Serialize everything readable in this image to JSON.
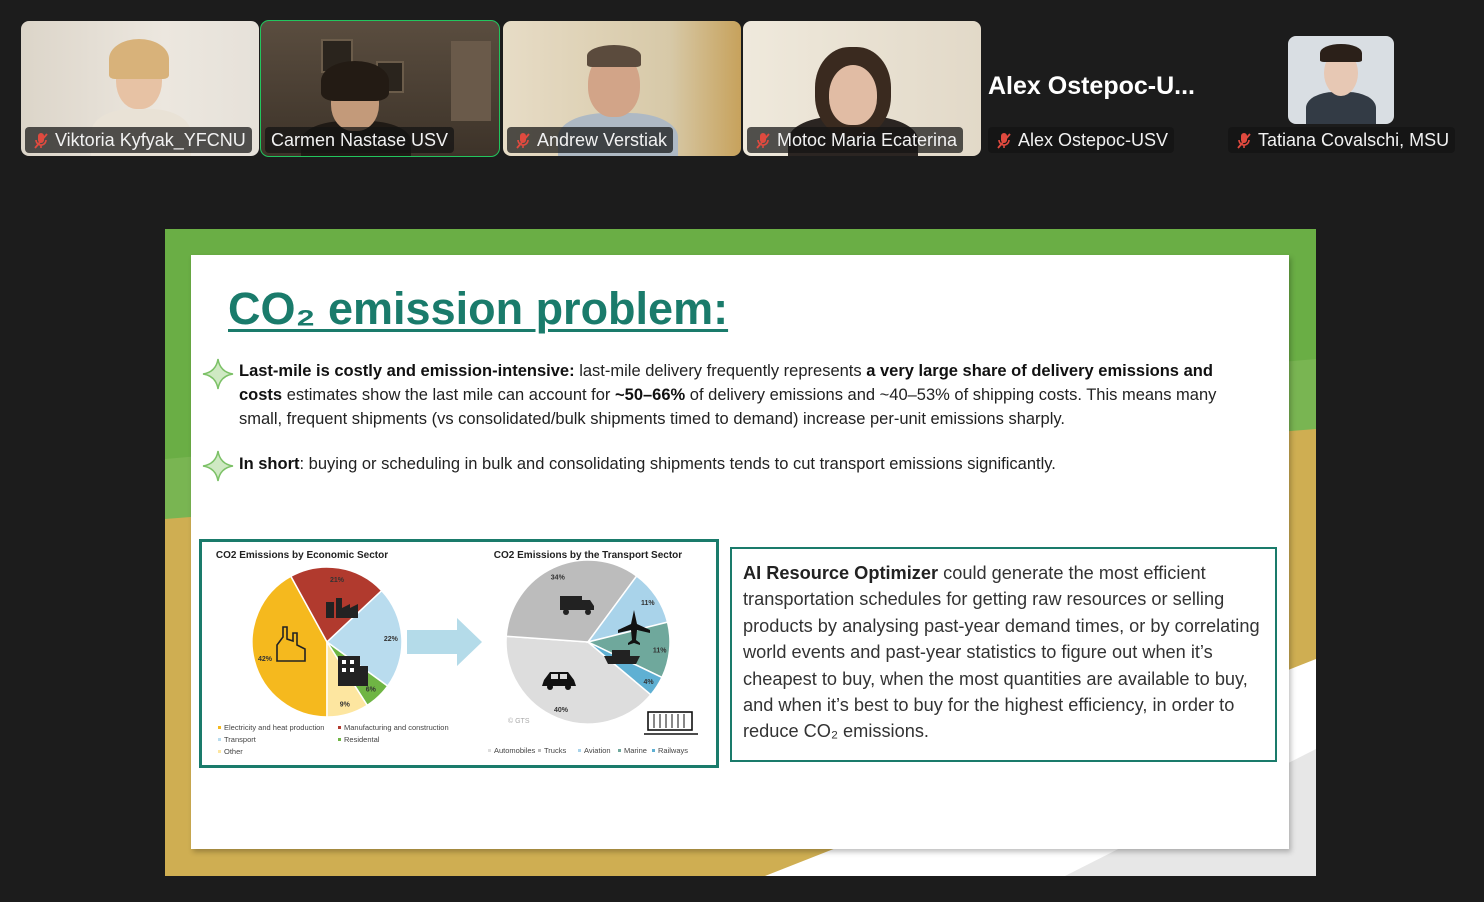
{
  "participants": [
    {
      "name": "Viktoria Kyfyak_YFCNU",
      "muted": true
    },
    {
      "name": "Carmen Nastase USV",
      "muted": true,
      "active_speaker": true
    },
    {
      "name": "Andrew Verstiak",
      "muted": true
    },
    {
      "name": "Motoc Maria Ecaterina",
      "muted": true
    },
    {
      "name": "Alex Ostepoc-USV",
      "muted": true,
      "display_text": "Alex  Ostepoc-U..."
    },
    {
      "name": "Tatiana Covalschi, MSU",
      "muted": true
    }
  ],
  "slide": {
    "title": "CO₂ emission problem:",
    "bullets": [
      {
        "b1": "Last-mile is costly and emission-intensive:",
        "t1": " last-mile delivery frequently represents ",
        "b2": "a very large share of delivery emissions and costs",
        "t2": " estimates show the last mile can account for ",
        "b3": "~50–66%",
        "t3": " of delivery emissions and ~40–53% of shipping costs. This means many small, frequent shipments (vs consolidated/bulk shipments timed to demand) increase per-unit emissions sharply."
      },
      {
        "b1": "In short",
        "t1": ": buying or scheduling in bulk and consolidating shipments tends to cut transport emissions significantly."
      }
    ],
    "ai_box": {
      "bold": "AI Resource Optimizer",
      "text": " could generate the most efficient transportation schedules for getting raw resources or selling products by analysing past-year demand times, or by correlating world events and past-year statistics to figure out when it’s cheapest to buy, when the most quantities are available to buy, and when it’s best to buy for the highest efficiency, in order to reduce CO₂ emissions."
    }
  },
  "chart_data": [
    {
      "type": "pie",
      "title": "CO2 Emissions by Economic Sector",
      "slices": [
        {
          "label": "Electricity and heat production",
          "value": 42,
          "color": "#f5b91e"
        },
        {
          "label": "Manufacturing and construction",
          "value": 21,
          "color": "#b13a2e"
        },
        {
          "label": "Transport",
          "value": 22,
          "color": "#b9dcee"
        },
        {
          "label": "Residental",
          "value": 6,
          "color": "#6fb544"
        },
        {
          "label": "Other",
          "value": 9,
          "color": "#fde6a0"
        }
      ]
    },
    {
      "type": "pie",
      "title": "CO2 Emissions by the Transport Sector",
      "slices": [
        {
          "label": "Automobiles",
          "value": 40,
          "color": "#dddddd"
        },
        {
          "label": "Trucks",
          "value": 34,
          "color": "#bcbcbc"
        },
        {
          "label": "Aviation",
          "value": 11,
          "color": "#a9d3ea"
        },
        {
          "label": "Marine",
          "value": 11,
          "color": "#6fa89c"
        },
        {
          "label": "Railways",
          "value": 4,
          "color": "#5fb0d3"
        }
      ],
      "watermark": "© GTS"
    }
  ],
  "icons": [
    "microphone-muted-icon",
    "sparkle-star-icon",
    "factory-icon",
    "buildings-icon",
    "houses-icon",
    "truck-icon",
    "airplane-icon",
    "ship-icon",
    "car-icon",
    "train-icon",
    "arrow-right-icon"
  ]
}
